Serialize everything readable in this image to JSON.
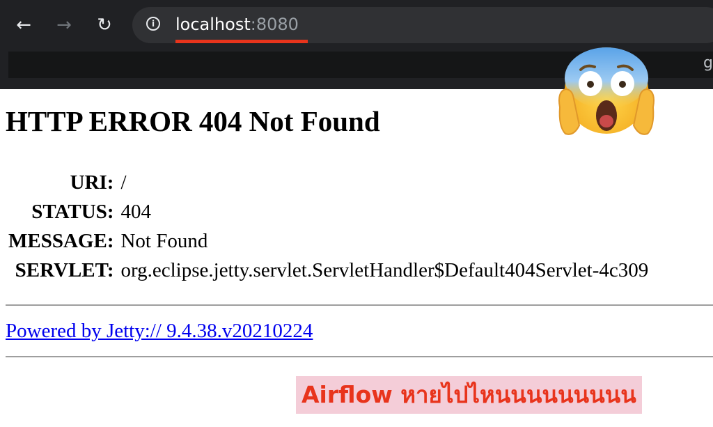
{
  "browser": {
    "url_host": "localhost",
    "url_port": ":8080"
  },
  "page": {
    "title": "HTTP ERROR 404 Not Found",
    "rows": [
      {
        "key": "URI:",
        "value": "/"
      },
      {
        "key": "STATUS:",
        "value": "404"
      },
      {
        "key": "MESSAGE:",
        "value": "Not Found"
      },
      {
        "key": "SERVLET:",
        "value": "org.eclipse.jetty.servlet.ServletHandler$Default404Servlet-4c309"
      }
    ],
    "powered_by": "Powered by Jetty:// 9.4.38.v20210224"
  },
  "caption": "Airflow หายไปไหนนนนนนนนน",
  "icons": {
    "back": "back-arrow-icon",
    "forward": "forward-arrow-icon",
    "reload": "reload-icon",
    "site_info": "info-icon",
    "emoji": "screaming-face-emoji"
  },
  "colors": {
    "highlight_red": "#e8341c",
    "caption_bg": "#f4cdd8",
    "link_blue": "#0000ee",
    "chrome_dark": "#202124"
  }
}
